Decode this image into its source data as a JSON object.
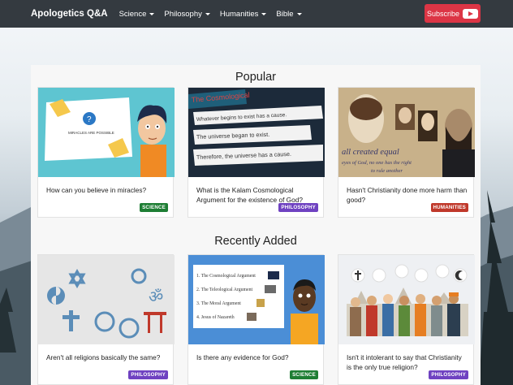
{
  "nav": {
    "brand": "Apologetics Q&A",
    "menus": [
      "Science",
      "Philosophy",
      "Humanities",
      "Bible"
    ],
    "subscribe": "Subscribe"
  },
  "popular": {
    "title": "Popular",
    "cards": [
      {
        "question": "How can you believe in miracles?",
        "tag": "SCIENCE",
        "tag_color": "#1e7e34",
        "thumb_text": "MIRACLES ARE POSSIBLE"
      },
      {
        "question": "What is the Kalam Cosmological Argument for the existence of God?",
        "tag": "PHILOSOPHY",
        "tag_color": "#6f42c1",
        "thumb_lines": [
          "The Cosmological",
          "Whatever begins to exist has a cause.",
          "The universe began to exist.",
          "Therefore, the universe has a cause."
        ]
      },
      {
        "question": "Hasn't Christianity done more harm than good?",
        "tag": "HUMANITIES",
        "tag_color": "#c0392b",
        "thumb_lines": [
          "all created equal",
          "eyes of God, no one has the right",
          "to rule another"
        ]
      }
    ]
  },
  "recent": {
    "title": "Recently Added",
    "cards": [
      {
        "question": "Aren't all religions basically the same?",
        "tag": "PHILOSOPHY",
        "tag_color": "#6f42c1"
      },
      {
        "question": "Is there any evidence for God?",
        "tag": "SCIENCE",
        "tag_color": "#1e7e34",
        "thumb_lines": [
          "1. The Cosmological Argument",
          "2. The Teleological Argument",
          "3. The Moral Argument",
          "4. Jesus of Nazareth"
        ]
      },
      {
        "question": "Isn't it intolerant to say that Christianity is the only true religion?",
        "tag": "PHILOSOPHY",
        "tag_color": "#6f42c1"
      }
    ]
  }
}
